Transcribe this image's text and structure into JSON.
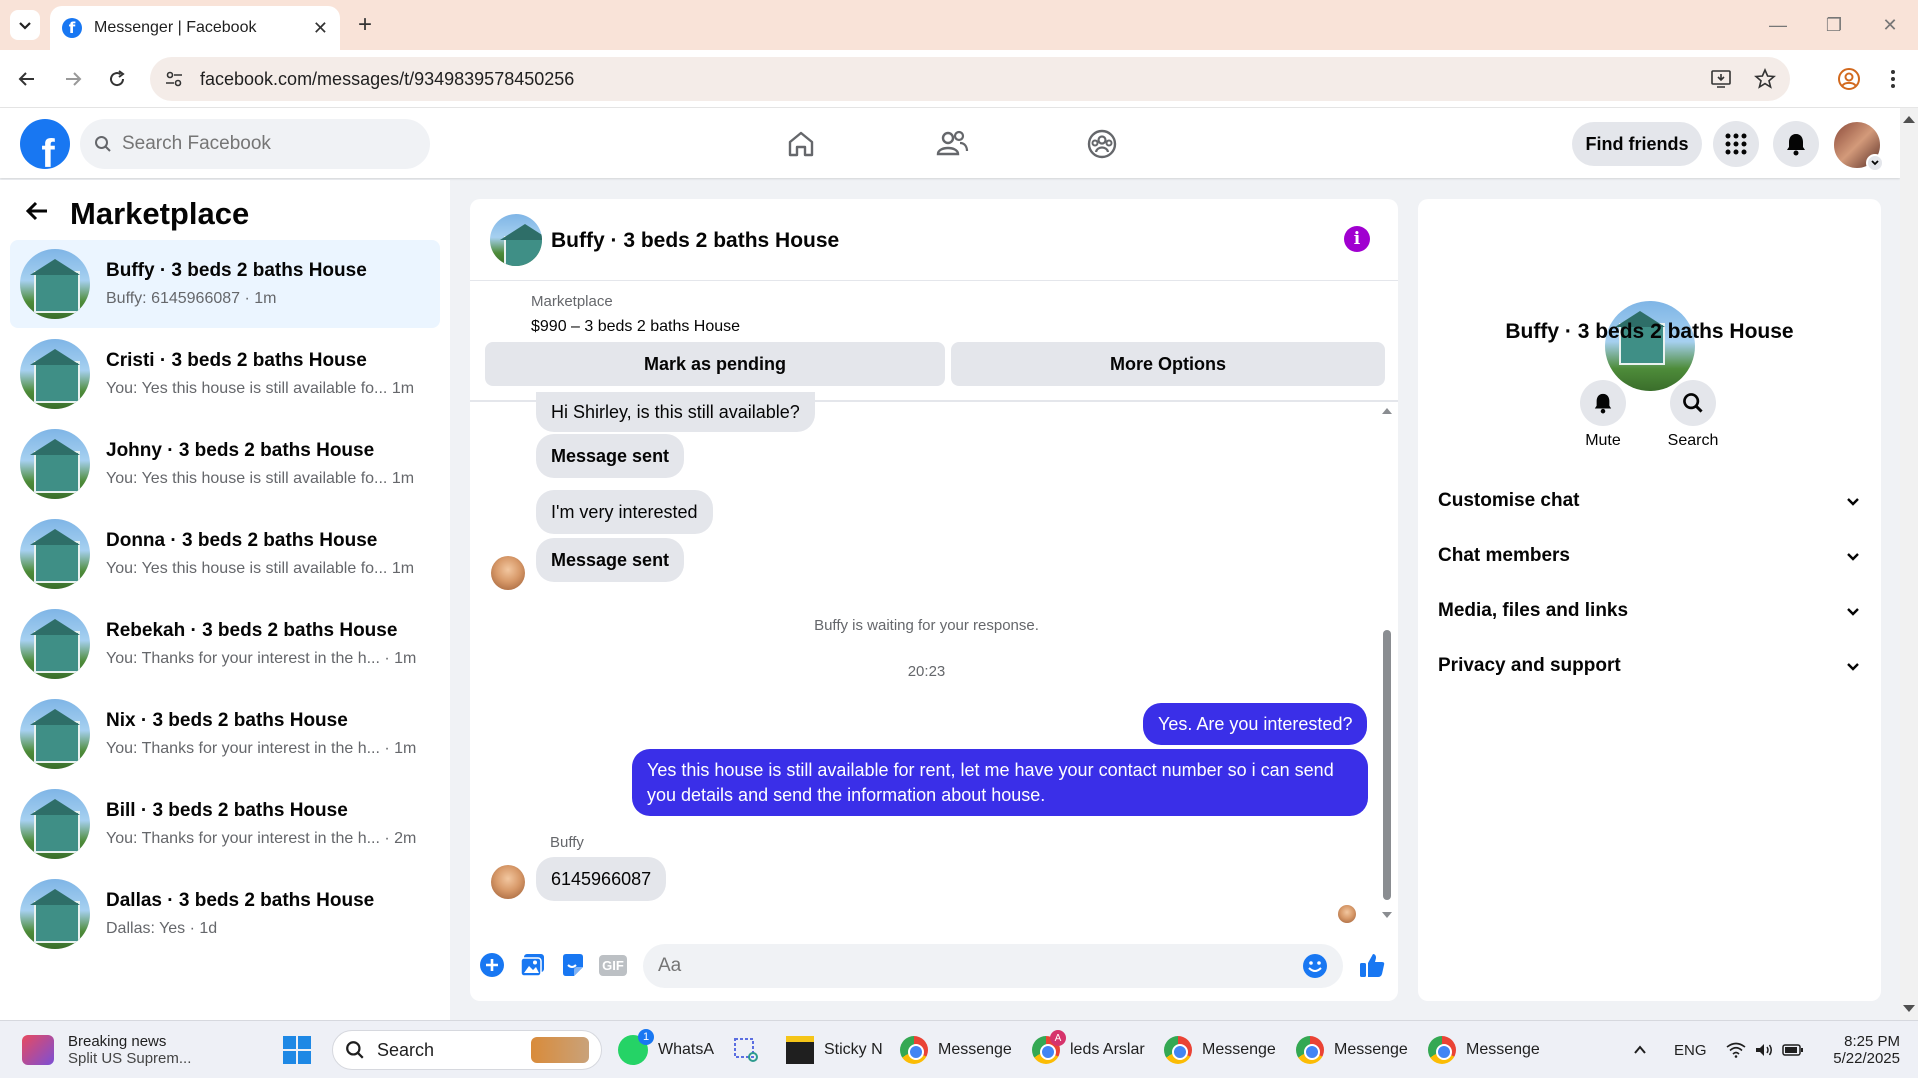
{
  "browser": {
    "tab_title": "Messenger | Facebook",
    "url": "facebook.com/messages/t/9349839578450256"
  },
  "fb": {
    "search_placeholder": "Search Facebook",
    "find_friends": "Find friends"
  },
  "sidebar": {
    "title": "Marketplace",
    "conversations": [
      {
        "name": "Buffy · 3 beds 2 baths House",
        "preview": "Buffy: 6145966087 · 1m"
      },
      {
        "name": "Cristi · 3 beds 2 baths House",
        "preview": "You: Yes this house is still available fo...  1m"
      },
      {
        "name": "Johny · 3 beds 2 baths House",
        "preview": "You: Yes this house is still available fo...  1m"
      },
      {
        "name": "Donna · 3 beds 2 baths House",
        "preview": "You: Yes this house is still available fo...  1m"
      },
      {
        "name": "Rebekah · 3 beds 2 baths House",
        "preview": "You: Thanks for your interest in the h... · 1m"
      },
      {
        "name": "Nix · 3 beds 2 baths House",
        "preview": "You: Thanks for your interest in the h... · 1m"
      },
      {
        "name": "Bill · 3 beds 2 baths House",
        "preview": "You: Thanks for your interest in the h... · 2m"
      },
      {
        "name": "Dallas · 3 beds 2 baths House",
        "preview": "Dallas: Yes · 1d"
      }
    ]
  },
  "chat": {
    "title": "Buffy · 3 beds 2 baths House",
    "marketplace_label": "Marketplace",
    "item_price": "$990 – 3 beds 2 baths House",
    "mark_pending": "Mark as pending",
    "more_options": "More Options",
    "msg1": "Hi Shirley, is this still available?",
    "msg2": "Message sent",
    "msg3": "I'm very interested",
    "msg4": "Message sent",
    "waiting": "Buffy is waiting for your response.",
    "time": "20:23",
    "out1": "Yes. Are you interested?",
    "out2": "Yes this house is still available for rent, let me have your contact number so i can send you details and send the information about house.",
    "sender": "Buffy",
    "msg5": "6145966087",
    "composer_placeholder": "Aa",
    "gif_label": "GIF"
  },
  "details": {
    "title": "Buffy · 3 beds 2 baths House",
    "mute": "Mute",
    "search": "Search",
    "rows": [
      "Customise chat",
      "Chat members",
      "Media, files and links",
      "Privacy and support"
    ]
  },
  "taskbar": {
    "news_title": "Breaking news",
    "news_sub": "Split US Suprem...",
    "search": "Search",
    "whatsapp": "WhatsA",
    "whatsapp_badge": "1",
    "sticky": "Sticky N",
    "chrome1": "Messenge",
    "chrome2": "leds Arslar",
    "chrome2_badge": "A",
    "chrome3": "Messenge",
    "chrome4": "Messenge",
    "chrome5": "Messenge",
    "lang": "ENG",
    "time": "8:25 PM",
    "date": "5/22/2025"
  },
  "colors": {
    "fb_blue": "#1877f2",
    "outgoing_bubble": "#3a2fe8",
    "info_purple": "#a000d0",
    "tab_strip": "#f9e3d8"
  }
}
